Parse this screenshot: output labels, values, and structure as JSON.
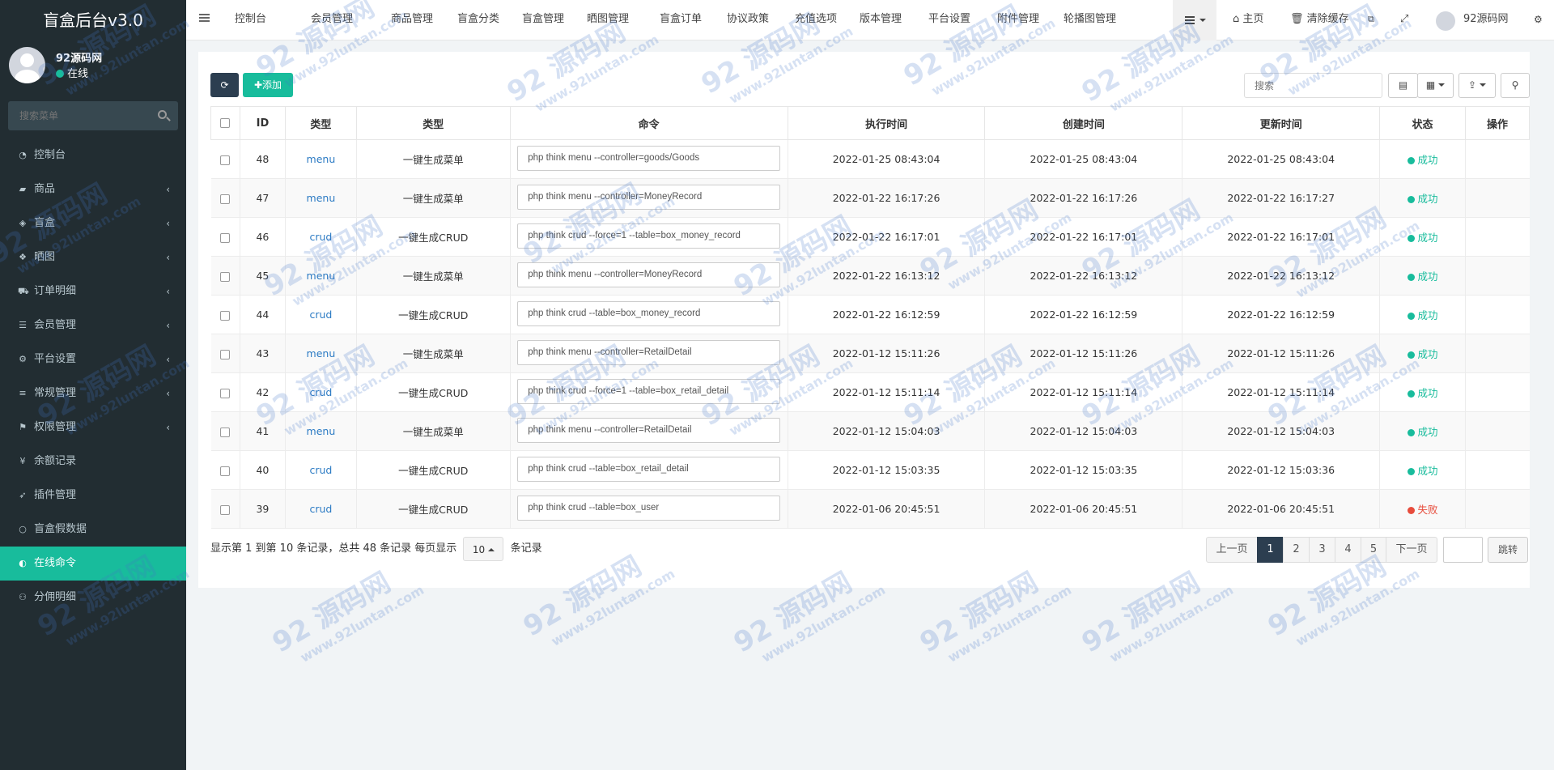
{
  "sidebar": {
    "logo": "盲盒后台v3.0",
    "user_name": "92源码网",
    "status": "在线",
    "search_placeholder": "搜索菜单",
    "items": [
      {
        "label": "控制台",
        "icon": "dashboard-icon",
        "has_children": false
      },
      {
        "label": "商品",
        "icon": "bag-icon",
        "has_children": true
      },
      {
        "label": "盲盒",
        "icon": "cube-icon",
        "has_children": true
      },
      {
        "label": "晒图",
        "icon": "dropbox-icon",
        "has_children": true
      },
      {
        "label": "订单明细",
        "icon": "cart-icon",
        "has_children": true
      },
      {
        "label": "会员管理",
        "icon": "list-icon",
        "has_children": true
      },
      {
        "label": "平台设置",
        "icon": "gear-icon",
        "has_children": true
      },
      {
        "label": "常规管理",
        "icon": "database-icon",
        "has_children": true
      },
      {
        "label": "权限管理",
        "icon": "group-icon",
        "has_children": true
      },
      {
        "label": "余额记录",
        "icon": "yen-icon",
        "has_children": false
      },
      {
        "label": "插件管理",
        "icon": "rocket-icon",
        "has_children": false
      },
      {
        "label": "盲盒假数据",
        "icon": "circle-icon",
        "has_children": false
      },
      {
        "label": "在线命令",
        "icon": "half-circle-icon",
        "has_children": false,
        "active": true
      },
      {
        "label": "分佣明细",
        "icon": "users-icon",
        "has_children": false
      }
    ]
  },
  "topnav": {
    "items": [
      "控制台",
      "会员管理",
      "商品管理",
      "盲盒分类",
      "盲盒管理",
      "晒图管理",
      "盲盒订单",
      "协议政策",
      "充值选项",
      "版本管理",
      "平台设置",
      "附件管理",
      "轮播图管理"
    ],
    "home": "主页",
    "clear_cache": "清除缓存",
    "username": "92源码网"
  },
  "toolbar": {
    "add_label": "添加",
    "search_placeholder": "搜索"
  },
  "table": {
    "headers": [
      "ID",
      "类型",
      "类型",
      "命令",
      "执行时间",
      "创建时间",
      "更新时间",
      "状态",
      "操作"
    ],
    "rows": [
      {
        "id": "48",
        "type": "menu",
        "type_name": "一键生成菜单",
        "command": "php think menu --controller=goods/Goods",
        "exec": "2022-01-25 08:43:04",
        "created": "2022-01-25 08:43:04",
        "updated": "2022-01-25 08:43:04",
        "status": "成功",
        "ok": true
      },
      {
        "id": "47",
        "type": "menu",
        "type_name": "一键生成菜单",
        "command": "php think menu --controller=MoneyRecord",
        "exec": "2022-01-22 16:17:26",
        "created": "2022-01-22 16:17:26",
        "updated": "2022-01-22 16:17:27",
        "status": "成功",
        "ok": true
      },
      {
        "id": "46",
        "type": "crud",
        "type_name": "一键生成CRUD",
        "command": "php think crud --force=1 --table=box_money_record",
        "exec": "2022-01-22 16:17:01",
        "created": "2022-01-22 16:17:01",
        "updated": "2022-01-22 16:17:01",
        "status": "成功",
        "ok": true
      },
      {
        "id": "45",
        "type": "menu",
        "type_name": "一键生成菜单",
        "command": "php think menu --controller=MoneyRecord",
        "exec": "2022-01-22 16:13:12",
        "created": "2022-01-22 16:13:12",
        "updated": "2022-01-22 16:13:12",
        "status": "成功",
        "ok": true
      },
      {
        "id": "44",
        "type": "crud",
        "type_name": "一键生成CRUD",
        "command": "php think crud --table=box_money_record",
        "exec": "2022-01-22 16:12:59",
        "created": "2022-01-22 16:12:59",
        "updated": "2022-01-22 16:12:59",
        "status": "成功",
        "ok": true
      },
      {
        "id": "43",
        "type": "menu",
        "type_name": "一键生成菜单",
        "command": "php think menu --controller=RetailDetail",
        "exec": "2022-01-12 15:11:26",
        "created": "2022-01-12 15:11:26",
        "updated": "2022-01-12 15:11:26",
        "status": "成功",
        "ok": true
      },
      {
        "id": "42",
        "type": "crud",
        "type_name": "一键生成CRUD",
        "command": "php think crud --force=1 --table=box_retail_detail",
        "exec": "2022-01-12 15:11:14",
        "created": "2022-01-12 15:11:14",
        "updated": "2022-01-12 15:11:14",
        "status": "成功",
        "ok": true
      },
      {
        "id": "41",
        "type": "menu",
        "type_name": "一键生成菜单",
        "command": "php think menu --controller=RetailDetail",
        "exec": "2022-01-12 15:04:03",
        "created": "2022-01-12 15:04:03",
        "updated": "2022-01-12 15:04:03",
        "status": "成功",
        "ok": true
      },
      {
        "id": "40",
        "type": "crud",
        "type_name": "一键生成CRUD",
        "command": "php think crud --table=box_retail_detail",
        "exec": "2022-01-12 15:03:35",
        "created": "2022-01-12 15:03:35",
        "updated": "2022-01-12 15:03:36",
        "status": "成功",
        "ok": true
      },
      {
        "id": "39",
        "type": "crud",
        "type_name": "一键生成CRUD",
        "command": "php think crud --table=box_user",
        "exec": "2022-01-06 20:45:51",
        "created": "2022-01-06 20:45:51",
        "updated": "2022-01-06 20:45:51",
        "status": "失败",
        "ok": false
      }
    ]
  },
  "footer": {
    "info_prefix": "显示第 1 到第 10 条记录，总共 48 条记录 每页显示",
    "page_size": "10",
    "info_suffix": "条记录",
    "prev": "上一页",
    "next": "下一页",
    "pages": [
      "1",
      "2",
      "3",
      "4",
      "5"
    ],
    "current_page": "1",
    "jump": "跳转"
  },
  "watermark": {
    "big": "92 源码网",
    "small": "www.92luntan.com"
  },
  "colors": {
    "sidebar_bg": "#222d32",
    "accent": "#18bc9c",
    "dark": "#2c3e50",
    "success": "#18bc9c",
    "danger": "#e74c3c"
  }
}
